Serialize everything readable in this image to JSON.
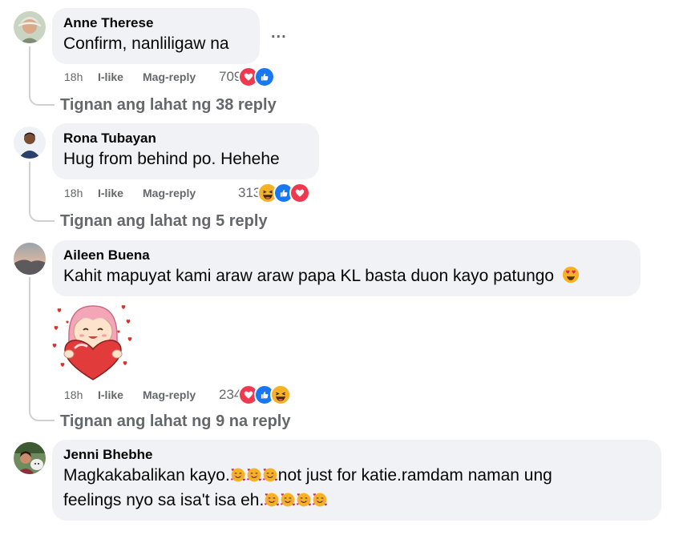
{
  "comments": [
    {
      "author": "Anne Therese",
      "text": "Confirm, nanliligaw na",
      "time": "18h",
      "like": "I-like",
      "reply": "Mag-reply",
      "count": "709",
      "reactions": [
        "heart",
        "like"
      ],
      "view_replies": "Tignan ang lahat ng 38 reply",
      "more": "..."
    },
    {
      "author": "Rona Tubayan",
      "text": "Hug from behind po. Hehehe",
      "time": "18h",
      "like": "I-like",
      "reply": "Mag-reply",
      "count": "313",
      "reactions": [
        "haha",
        "like",
        "heart"
      ],
      "view_replies": "Tignan ang lahat ng 5 reply"
    },
    {
      "author": "Aileen Buena",
      "text": "Kahit mapuyat kami araw araw papa KL basta duon kayo patungo",
      "text_emoji": "heart-eyes",
      "sticker": "girl-holding-heart-sticker",
      "time": "18h",
      "like": "I-like",
      "reply": "Mag-reply",
      "count": "234",
      "reactions": [
        "heart",
        "like",
        "haha"
      ],
      "view_replies": "Tignan ang lahat ng 9 na reply"
    },
    {
      "author": "Jenni Bhebhe",
      "line1_a": "Magkakabalikan kayo.",
      "line1_emoji_count": 3,
      "line1_b": "not just for katie.ramdam naman ung",
      "line2_a": "feelings nyo sa isa't isa eh.",
      "line2_emoji_count": 4,
      "text_emoji": "smiling-face-with-hearts"
    }
  ],
  "colors": {
    "bubble": "#f0f2f5",
    "secondary_text": "#65676b",
    "heart": "#f0394f",
    "like": "#1877f2",
    "haha": "#f7b125"
  }
}
